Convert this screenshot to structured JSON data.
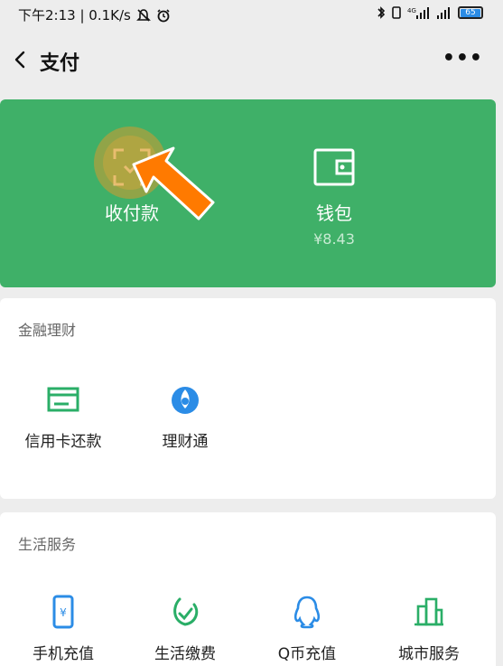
{
  "status_bar": {
    "left_text": "下午2:13 | 0.1K/s",
    "icons": [
      "mute-icon",
      "alarm-icon",
      "bluetooth-icon",
      "vibrate-icon",
      "signal-4g-icon",
      "signal-icon"
    ],
    "battery": "65"
  },
  "nav": {
    "title": "支付",
    "more_label": "•••"
  },
  "pay_card": {
    "color": "#3fb068",
    "collect_label": "收付款",
    "wallet_label": "钱包",
    "wallet_amount": "¥8.43"
  },
  "finance": {
    "title": "金融理财",
    "items": [
      {
        "label": "信用卡还款",
        "icon": "credit-card-icon"
      },
      {
        "label": "理财通",
        "icon": "wealth-icon"
      }
    ]
  },
  "life": {
    "title": "生活服务",
    "items": [
      {
        "label": "手机充值",
        "icon": "phone-topup-icon"
      },
      {
        "label": "生活缴费",
        "icon": "utility-bill-icon"
      },
      {
        "label": "Q币充值",
        "icon": "qq-coin-icon"
      },
      {
        "label": "城市服务",
        "icon": "city-service-icon"
      }
    ]
  }
}
